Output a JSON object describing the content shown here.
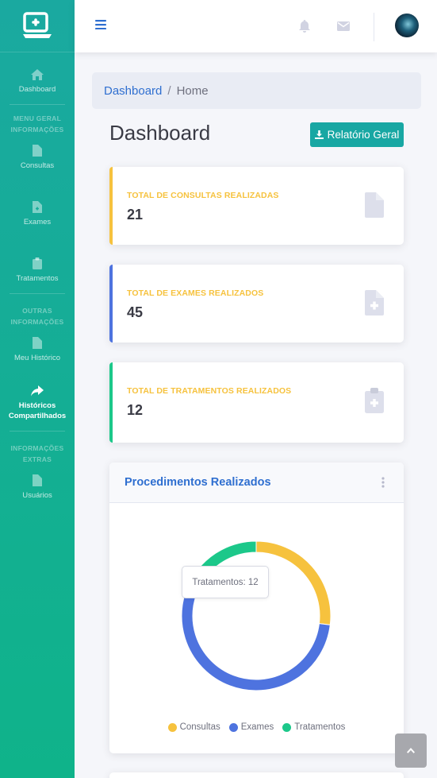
{
  "sidebar": {
    "items": [
      {
        "label": "Dashboard",
        "icon": "home-icon"
      },
      {
        "label": "Consultas",
        "icon": "file-icon"
      },
      {
        "label": "Exames",
        "icon": "file-medical-icon"
      },
      {
        "label": "Tratamentos",
        "icon": "clipboard-icon"
      },
      {
        "label": "Meu Histórico",
        "icon": "file-icon"
      },
      {
        "label": "Históricos Compartilhados",
        "icon": "share-icon"
      },
      {
        "label": "Usuários",
        "icon": "file-icon"
      }
    ],
    "headings": {
      "geral": "MENU GERAL INFORMAÇÕES",
      "outras": "OUTRAS INFORMAÇÕES",
      "extras": "INFORMAÇÕES EXTRAS"
    }
  },
  "breadcrumb": {
    "root": "Dashboard",
    "separator": "/",
    "current": "Home"
  },
  "page": {
    "title": "Dashboard",
    "report_button": "Relatório Geral"
  },
  "cards": [
    {
      "title": "TOTAL DE CONSULTAS REALIZADAS",
      "value": "21",
      "color": "#f6c23e"
    },
    {
      "title": "TOTAL DE EXAMES REALIZADOS",
      "value": "45",
      "color": "#4e73df"
    },
    {
      "title": "TOTAL DE TRATAMENTOS REALIZADOS",
      "value": "12",
      "color": "#1cc88a"
    }
  ],
  "chart": {
    "title": "Procedimentos Realizados",
    "tooltip": "Tratamentos: 12"
  },
  "chart_data": {
    "type": "pie",
    "variant": "doughnut",
    "categories": [
      "Consultas",
      "Exames",
      "Tratamentos"
    ],
    "values": [
      21,
      45,
      12
    ],
    "colors": [
      "#f6c23e",
      "#4e73df",
      "#1cc88a"
    ],
    "legend_position": "bottom"
  },
  "colors": {
    "accent": "#18a7a3",
    "link": "#2f6fd0"
  }
}
